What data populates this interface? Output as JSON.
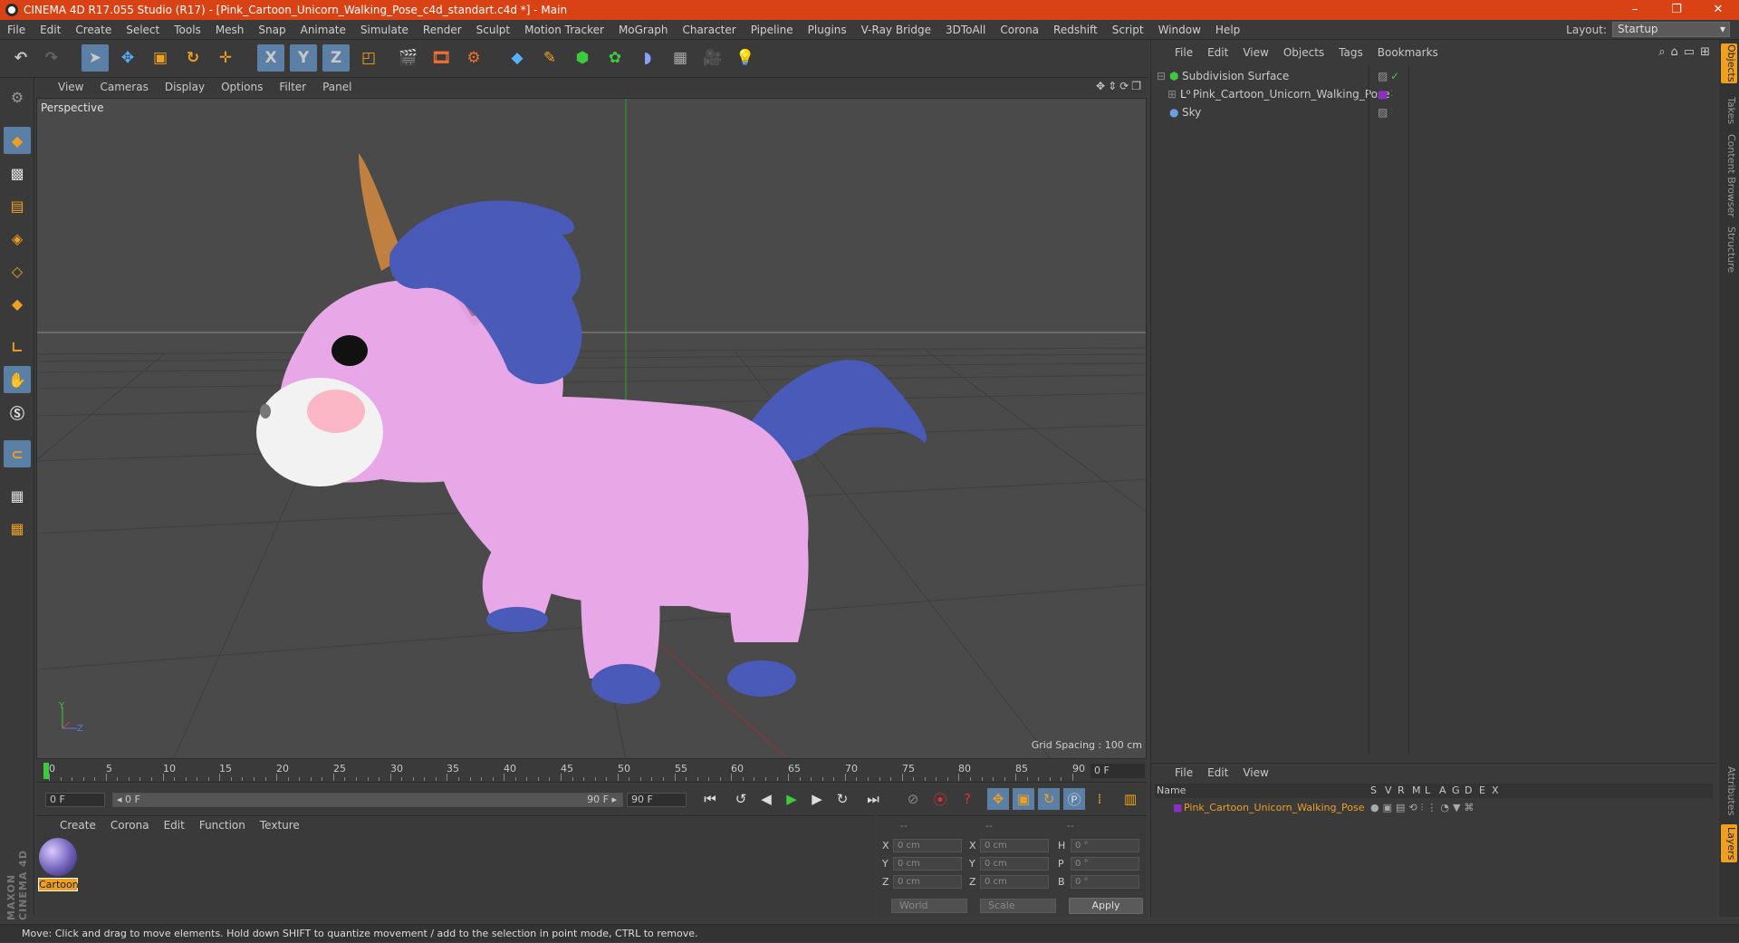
{
  "window": {
    "title": "CINEMA 4D R17.055 Studio (R17) - [Pink_Cartoon_Unicorn_Walking_Pose_c4d_standart.c4d *] - Main",
    "controls": [
      "–",
      "❐",
      "✕"
    ]
  },
  "menubar": {
    "items": [
      "File",
      "Edit",
      "Create",
      "Select",
      "Tools",
      "Mesh",
      "Snap",
      "Animate",
      "Simulate",
      "Render",
      "Sculpt",
      "Motion Tracker",
      "MoGraph",
      "Character",
      "Pipeline",
      "Plugins",
      "V-Ray Bridge",
      "3DToAll",
      "Corona",
      "Redshift",
      "Script",
      "Window",
      "Help"
    ],
    "layout_label": "Layout:",
    "layout_value": "Startup"
  },
  "toolbar": {
    "icons": [
      "undo-icon",
      "redo-icon",
      "select-arrow-icon",
      "move-icon",
      "scale-icon",
      "rotate-icon",
      "move-plus-icon",
      "x-axis-icon",
      "y-axis-icon",
      "z-axis-icon",
      "coordinate-system-icon",
      "render-view-icon",
      "render-picture-viewer-icon",
      "render-settings-icon",
      "cube-icon",
      "pen-icon",
      "subdivision-icon",
      "array-icon",
      "deformer-icon",
      "floor-icon",
      "camera-icon",
      "light-icon"
    ],
    "axis_labels": [
      "X",
      "Y",
      "Z"
    ]
  },
  "viewport": {
    "menu": [
      "View",
      "Cameras",
      "Display",
      "Options",
      "Filter",
      "Panel"
    ],
    "label": "Perspective",
    "grid_spacing": "Grid Spacing : 100 cm",
    "axis": {
      "x": "X",
      "y": "Y",
      "z": "Z"
    }
  },
  "timeline": {
    "ticks": [
      "0",
      "5",
      "10",
      "15",
      "20",
      "25",
      "30",
      "35",
      "40",
      "45",
      "50",
      "55",
      "60",
      "65",
      "70",
      "75",
      "80",
      "85",
      "90"
    ],
    "current_frame": "0 F"
  },
  "playbar": {
    "start": "0 F",
    "range_start": "◂ 0 F",
    "range_end": "90 F ▸",
    "end": "90 F"
  },
  "materials": {
    "menu": [
      "Create",
      "Corona",
      "Edit",
      "Function",
      "Texture"
    ],
    "items": [
      {
        "name": "Cartoon"
      }
    ]
  },
  "coordinates": {
    "headers": [
      "--",
      "--",
      "--"
    ],
    "rows": [
      {
        "a": "X",
        "av": "0 cm",
        "b": "X",
        "bv": "0 cm",
        "c": "H",
        "cv": "0 °"
      },
      {
        "a": "Y",
        "av": "0 cm",
        "b": "Y",
        "bv": "0 cm",
        "c": "P",
        "cv": "0 °"
      },
      {
        "a": "Z",
        "av": "0 cm",
        "b": "Z",
        "bv": "0 cm",
        "c": "B",
        "cv": "0 °"
      }
    ],
    "mode1": "World",
    "mode2": "Scale",
    "apply": "Apply"
  },
  "objects": {
    "menu": [
      "File",
      "Edit",
      "View",
      "Objects",
      "Tags",
      "Bookmarks"
    ],
    "items": [
      {
        "name": "Subdivision Surface"
      },
      {
        "name": "Pink_Cartoon_Unicorn_Walking_Pose"
      },
      {
        "name": "Sky"
      }
    ]
  },
  "layers": {
    "menu": [
      "File",
      "Edit",
      "View"
    ],
    "headers": [
      "Name",
      "S",
      "V",
      "R",
      "M",
      "L",
      "A",
      "G",
      "D",
      "E",
      "X"
    ],
    "row": "Pink_Cartoon_Unicorn_Walking_Pose"
  },
  "sidetabs": [
    "Objects",
    "Takes",
    "Content Browser",
    "Structure",
    "Attributes",
    "Layers"
  ],
  "status": "Move: Click and drag to move elements. Hold down SHIFT to quantize movement / add to the selection in point mode, CTRL to remove.",
  "branding": "MAXON CINEMA 4D",
  "colors": {
    "title_bar": "#d94215",
    "accent_orange": "#f0a020",
    "selected_blue": "#5c7fa6",
    "unicorn_body": "#e8a8e8",
    "unicorn_mane": "#4a5ab8"
  }
}
